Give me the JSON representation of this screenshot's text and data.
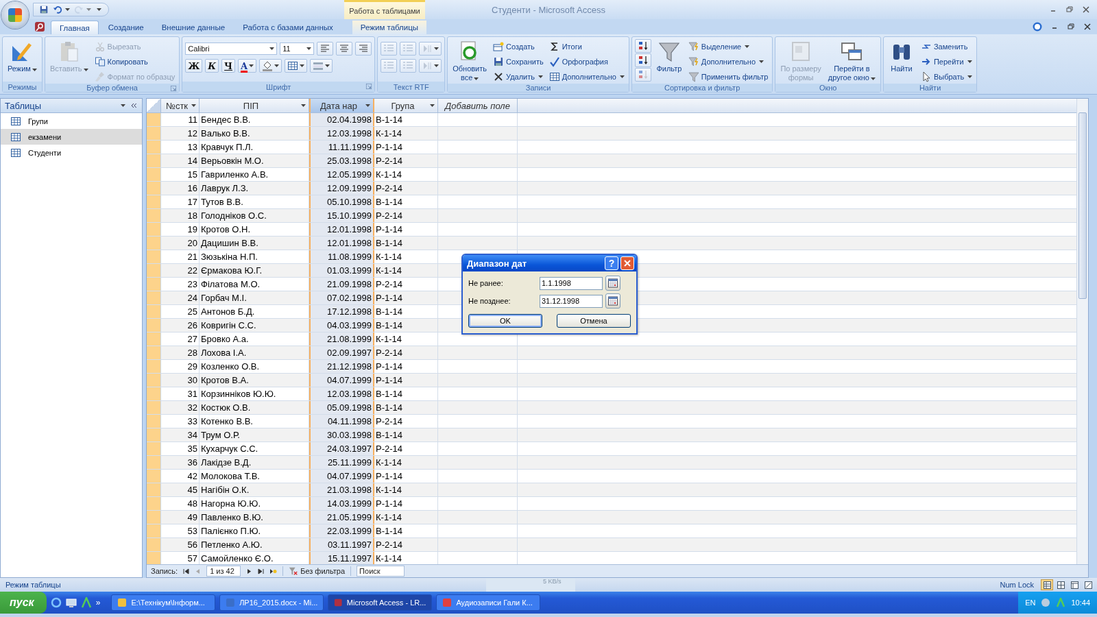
{
  "window": {
    "title": "Студенти - Microsoft Access",
    "context_group": "Работа с таблицами"
  },
  "quick_access": [
    {
      "kind": "save",
      "menu": false,
      "disabled": false
    },
    {
      "kind": "undo",
      "menu": true,
      "disabled": false
    },
    {
      "kind": "redo",
      "menu": true,
      "disabled": true
    }
  ],
  "ribbon_tabs": [
    {
      "label": "Главная",
      "selected": true,
      "kind": "standard"
    },
    {
      "label": "Создание",
      "selected": false,
      "kind": "standard"
    },
    {
      "label": "Внешние данные",
      "selected": false,
      "kind": "standard"
    },
    {
      "label": "Работа с базами данных",
      "selected": false,
      "kind": "standard"
    },
    {
      "label": "Режим таблицы",
      "selected": false,
      "kind": "contextual"
    }
  ],
  "ribbon_groups": [
    {
      "title": "Режимы",
      "launcher": false,
      "kind": "columns",
      "columns": [
        [
          {
            "kind": "large",
            "label": "Режим",
            "disabled": false,
            "menu": true
          }
        ]
      ]
    },
    {
      "title": "Буфер обмена",
      "launcher": true,
      "kind": "columns",
      "columns": [
        [
          {
            "kind": "large",
            "label": "Вставить",
            "disabled": true,
            "menu": true
          }
        ],
        [
          {
            "kind": "small",
            "label": "Вырезать",
            "disabled": true,
            "menu": false
          },
          {
            "kind": "small",
            "label": "Копировать",
            "disabled": false,
            "menu": false
          },
          {
            "kind": "small",
            "label": "Формат по образцу",
            "disabled": true,
            "menu": false
          }
        ]
      ]
    },
    {
      "title": "Шрифт",
      "launcher": true,
      "kind": "rows",
      "columns": [
        [
          {
            "kind": "font-field",
            "value": "Calibri"
          },
          {
            "kind": "size-field",
            "value": "11"
          },
          {
            "kind": "icon",
            "disabled": false,
            "menu": false
          },
          {
            "kind": "icon",
            "disabled": false,
            "menu": false
          },
          {
            "kind": "icon",
            "disabled": false,
            "menu": false
          }
        ],
        [
          {
            "kind": "glyph",
            "label": "Ж",
            "disabled": false,
            "menu": false
          },
          {
            "kind": "glyph",
            "label": "К",
            "disabled": false,
            "menu": false
          },
          {
            "kind": "glyph",
            "label": "Ч",
            "disabled": false,
            "menu": false
          },
          {
            "kind": "glyph",
            "label": "A",
            "disabled": false,
            "menu": true
          },
          {
            "kind": "icon",
            "disabled": false,
            "menu": true
          },
          {
            "kind": "icon",
            "disabled": false,
            "menu": true
          },
          {
            "kind": "icon",
            "disabled": false,
            "menu": true
          }
        ]
      ]
    },
    {
      "title": "Текст RTF",
      "launcher": false,
      "kind": "rows",
      "columns": [
        [
          {
            "kind": "icon",
            "disabled": true,
            "menu": false
          },
          {
            "kind": "icon",
            "disabled": true,
            "menu": false
          },
          {
            "kind": "icon",
            "disabled": true,
            "menu": true
          }
        ],
        [
          {
            "kind": "icon",
            "disabled": true,
            "menu": false
          },
          {
            "kind": "icon",
            "disabled": true,
            "menu": false
          },
          {
            "kind": "icon",
            "disabled": true,
            "menu": true
          }
        ]
      ]
    },
    {
      "title": "Записи",
      "launcher": false,
      "kind": "columns",
      "columns": [
        [
          {
            "kind": "large",
            "label": "Обновить\nвсе",
            "disabled": false,
            "menu": true
          }
        ],
        [
          {
            "kind": "small",
            "label": "Создать",
            "disabled": false,
            "menu": false
          },
          {
            "kind": "small",
            "label": "Сохранить",
            "disabled": false,
            "menu": false
          },
          {
            "kind": "small",
            "label": "Удалить",
            "disabled": false,
            "menu": true
          }
        ],
        [
          {
            "kind": "small",
            "label": "Итоги",
            "disabled": false,
            "menu": false
          },
          {
            "kind": "small",
            "label": "Орфография",
            "disabled": false,
            "menu": false
          },
          {
            "kind": "small",
            "label": "Дополнительно",
            "disabled": false,
            "menu": true
          }
        ]
      ]
    },
    {
      "title": "Сортировка и фильтр",
      "launcher": false,
      "kind": "columns",
      "columns": [
        [
          {
            "kind": "icon",
            "disabled": false,
            "menu": false
          },
          {
            "kind": "icon",
            "disabled": false,
            "menu": false
          },
          {
            "kind": "icon",
            "disabled": true,
            "menu": false
          }
        ],
        [
          {
            "kind": "large",
            "label": "Фильтр",
            "disabled": false,
            "menu": false
          }
        ],
        [
          {
            "kind": "small",
            "label": "Выделение",
            "disabled": false,
            "menu": true
          },
          {
            "kind": "small",
            "label": "Дополнительно",
            "disabled": false,
            "menu": true
          },
          {
            "kind": "small",
            "label": "Применить фильтр",
            "disabled": false,
            "menu": false
          }
        ]
      ]
    },
    {
      "title": "Окно",
      "launcher": false,
      "kind": "columns",
      "columns": [
        [
          {
            "kind": "large",
            "label": "По размеру\nформы",
            "disabled": true,
            "menu": false
          }
        ],
        [
          {
            "kind": "large",
            "label": "Перейти в\nдругое окно",
            "disabled": false,
            "menu": true
          }
        ]
      ]
    },
    {
      "title": "Найти",
      "launcher": false,
      "kind": "columns",
      "columns": [
        [
          {
            "kind": "large",
            "label": "Найти",
            "disabled": false,
            "menu": false
          }
        ],
        [
          {
            "kind": "small",
            "label": "Заменить",
            "disabled": false,
            "menu": false
          },
          {
            "kind": "small",
            "label": "Перейти",
            "disabled": false,
            "menu": true
          },
          {
            "kind": "small",
            "label": "Выбрать",
            "disabled": false,
            "menu": true
          }
        ]
      ]
    }
  ],
  "nav_pane": {
    "title": "Таблицы",
    "items": [
      {
        "label": "Групи",
        "selected": false
      },
      {
        "label": "екзамени",
        "selected": true
      },
      {
        "label": "Студенти",
        "selected": false
      }
    ]
  },
  "table": {
    "columns": [
      {
        "label": "№стк",
        "kind": "number",
        "menu": true,
        "selected": false
      },
      {
        "label": "ПІП",
        "kind": "text",
        "menu": true,
        "selected": false
      },
      {
        "label": "Дата нар",
        "kind": "date",
        "menu": true,
        "selected": true
      },
      {
        "label": "Група",
        "kind": "text",
        "menu": true,
        "selected": false
      },
      {
        "label": "Добавить поле",
        "kind": "add",
        "menu": false,
        "selected": false
      }
    ],
    "rows": [
      [
        "11",
        "Бендес В.В.",
        "02.04.1998",
        "В-1-14"
      ],
      [
        "12",
        "Валько В.В.",
        "12.03.1998",
        "К-1-14"
      ],
      [
        "13",
        "Кравчук П.Л.",
        "11.11.1999",
        "Р-1-14"
      ],
      [
        "14",
        "Верьовкін М.О.",
        "25.03.1998",
        "Р-2-14"
      ],
      [
        "15",
        "Гавриленко А.В.",
        "12.05.1999",
        "К-1-14"
      ],
      [
        "16",
        "Лаврук Л.З.",
        "12.09.1999",
        "Р-2-14"
      ],
      [
        "17",
        "Тутов В.В.",
        "05.10.1998",
        "В-1-14"
      ],
      [
        "18",
        "Голодніков О.С.",
        "15.10.1999",
        "Р-2-14"
      ],
      [
        "19",
        "Кротов О.Н.",
        "12.01.1998",
        "Р-1-14"
      ],
      [
        "20",
        "Дацишин В.В.",
        "12.01.1998",
        "В-1-14"
      ],
      [
        "21",
        "Зюзькіна Н.П.",
        "11.08.1999",
        "К-1-14"
      ],
      [
        "22",
        "Єрмакова Ю.Г.",
        "01.03.1999",
        "К-1-14"
      ],
      [
        "23",
        "Філатова М.О.",
        "21.09.1998",
        "Р-2-14"
      ],
      [
        "24",
        "Горбач М.І.",
        "07.02.1998",
        "Р-1-14"
      ],
      [
        "25",
        "Антонов Б.Д.",
        "17.12.1998",
        "В-1-14"
      ],
      [
        "26",
        "Ковригін С.С.",
        "04.03.1999",
        "В-1-14"
      ],
      [
        "27",
        "Бровко А.а.",
        "21.08.1999",
        "К-1-14"
      ],
      [
        "28",
        "Лохова І.А.",
        "02.09.1997",
        "Р-2-14"
      ],
      [
        "29",
        "Козленко О.В.",
        "21.12.1998",
        "Р-1-14"
      ],
      [
        "30",
        "Кротов В.А.",
        "04.07.1999",
        "Р-1-14"
      ],
      [
        "31",
        "Корзинніков Ю.Ю.",
        "12.03.1998",
        "В-1-14"
      ],
      [
        "32",
        "Костюк О.В.",
        "05.09.1998",
        "В-1-14"
      ],
      [
        "33",
        "Котенко В.В.",
        "04.11.1998",
        "Р-2-14"
      ],
      [
        "34",
        "Трум О.Р.",
        "30.03.1998",
        "В-1-14"
      ],
      [
        "35",
        "Кухарчук С.С.",
        "24.03.1997",
        "Р-2-14"
      ],
      [
        "36",
        "Лакідзе В.Д.",
        "25.11.1999",
        "К-1-14"
      ],
      [
        "42",
        "Молокова Т.В.",
        "04.07.1999",
        "Р-1-14"
      ],
      [
        "45",
        "Нагібін О.К.",
        "21.03.1998",
        "К-1-14"
      ],
      [
        "48",
        "Нагорна Ю.Ю.",
        "14.03.1999",
        "Р-1-14"
      ],
      [
        "49",
        "Павленко В.Ю.",
        "21.05.1999",
        "К-1-14"
      ],
      [
        "53",
        "Палієнко П.Ю.",
        "22.03.1999",
        "В-1-14"
      ],
      [
        "56",
        "Петленко А.Ю.",
        "03.11.1997",
        "Р-2-14"
      ],
      [
        "57",
        "Самойленко Є.О.",
        "15.11.1997",
        "К-1-14"
      ]
    ]
  },
  "record_nav": {
    "label": "Запись:",
    "position": "1 из 42",
    "filter": "Без фильтра",
    "search_placeholder": "Поиск"
  },
  "dialog": {
    "title": "Диапазон дат",
    "help": "?",
    "fields": [
      {
        "label": "Не ранее:",
        "value": "1.1.1998"
      },
      {
        "label": "Не позднее:",
        "value": "31.12.1998"
      }
    ],
    "buttons": [
      {
        "label": "OK",
        "default": true
      },
      {
        "label": "Отмена",
        "default": false
      }
    ]
  },
  "status_bar": {
    "text": "Режим таблицы",
    "network_reading": "5 KB/s",
    "num_lock": "Num Lock",
    "views": [
      {
        "selected": true
      },
      {
        "selected": false
      },
      {
        "selected": false
      },
      {
        "selected": false
      }
    ]
  },
  "taskbar": {
    "start": "пуск",
    "more": "»",
    "tasks": [
      {
        "label": "E:\\Технікум\\Інформ...",
        "selected": false
      },
      {
        "label": "ЛР16_2015.docx - Mi...",
        "selected": false
      },
      {
        "label": "Microsoft Access - LR...",
        "selected": true
      },
      {
        "label": "Аудиозаписи Гали К...",
        "selected": false
      }
    ],
    "language": "EN",
    "clock": "10:44"
  }
}
